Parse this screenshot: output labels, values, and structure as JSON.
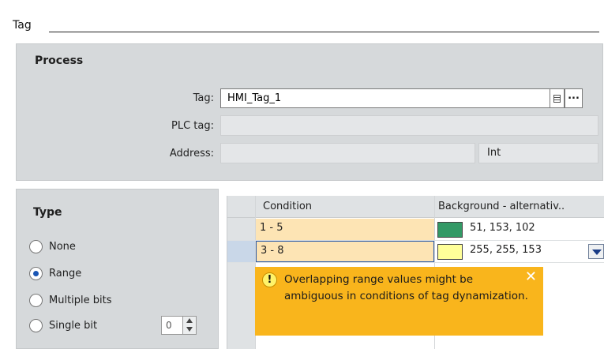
{
  "header": {
    "title": "Tag"
  },
  "process": {
    "title": "Process",
    "tag_label": "Tag:",
    "tag_value": "HMI_Tag_1",
    "more_button": "...",
    "plc_tag_label": "PLC tag:",
    "plc_tag_value": "",
    "address_label": "Address:",
    "address_value": "",
    "data_type_value": "Int"
  },
  "type": {
    "title": "Type",
    "options": [
      {
        "label": "None",
        "checked": false
      },
      {
        "label": "Range",
        "checked": true
      },
      {
        "label": "Multiple bits",
        "checked": false
      },
      {
        "label": "Single bit",
        "checked": false
      }
    ],
    "bit_value": "0"
  },
  "grid": {
    "columns": [
      "Condition",
      "Background - alternativ.."
    ],
    "rows": [
      {
        "condition": "1 - 5",
        "color_hex": "#339966",
        "color_text": "51, 153, 102"
      },
      {
        "condition": "3 - 8",
        "color_hex": "#ffff99",
        "color_text": "255, 255, 153"
      }
    ]
  },
  "tooltip": {
    "message": "Overlapping range values might be ambiguous in conditions of tag dynamization.",
    "icon": "warning-icon"
  }
}
